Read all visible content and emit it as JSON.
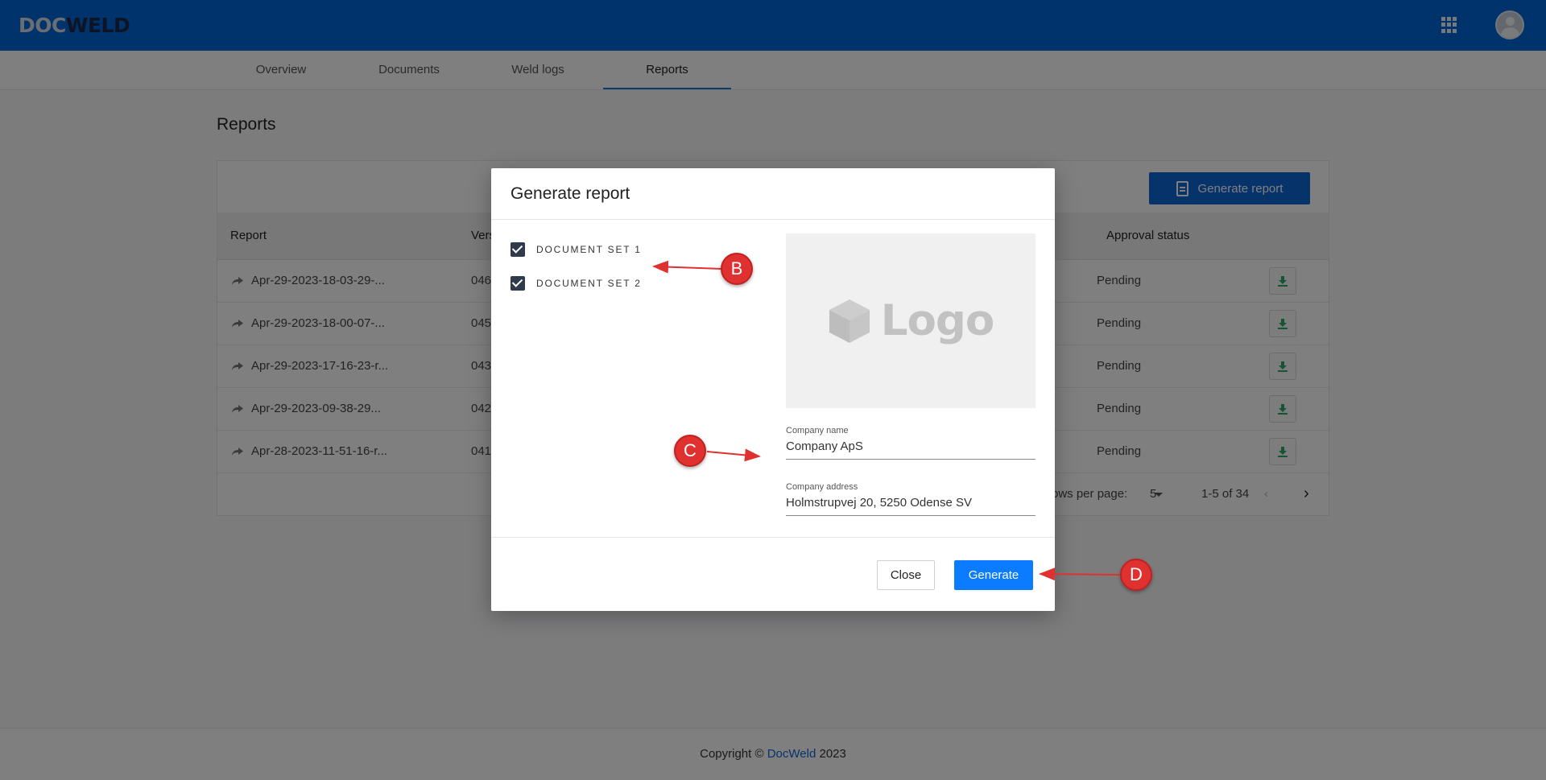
{
  "header": {
    "logo_doc": "DOC",
    "logo_weld": "WELD"
  },
  "tabs": [
    {
      "label": "Overview"
    },
    {
      "label": "Documents"
    },
    {
      "label": "Weld logs"
    },
    {
      "label": "Reports",
      "active": true
    }
  ],
  "page": {
    "title": "Reports",
    "generate_button": "Generate report"
  },
  "table": {
    "columns": [
      "Report",
      "Vers",
      "Approval status"
    ],
    "rows": [
      {
        "report": "Apr-29-2023-18-03-29-...",
        "version": "046",
        "status": "Pending"
      },
      {
        "report": "Apr-29-2023-18-00-07-...",
        "version": "045",
        "status": "Pending"
      },
      {
        "report": "Apr-29-2023-17-16-23-r...",
        "version": "043",
        "status": "Pending"
      },
      {
        "report": "Apr-29-2023-09-38-29...",
        "version": "042",
        "status": "Pending"
      },
      {
        "report": "Apr-28-2023-11-51-16-r...",
        "version": "041",
        "status": "Pending"
      }
    ],
    "pagination": {
      "rows_label": "ows per page:",
      "rows_value": "5",
      "range": "1-5 of 34"
    }
  },
  "footer": {
    "prefix": "Copyright ©",
    "brand": "DocWeld",
    "year": "2023"
  },
  "modal": {
    "title": "Generate report",
    "checkboxes": [
      {
        "label": "DOCUMENT SET 1",
        "checked": true
      },
      {
        "label": "DOCUMENT SET 2",
        "checked": true
      }
    ],
    "logo_placeholder": "Logo",
    "company_name_label": "Company name",
    "company_name_value": "Company ApS",
    "company_address_label": "Company address",
    "company_address_value": "Holmstrupvej 20, 5250 Odense SV",
    "close_button": "Close",
    "generate_button": "Generate"
  },
  "annotations": [
    "B",
    "C",
    "D"
  ],
  "colors": {
    "brand_blue": "#0064d9",
    "primary_button": "#0b7cff",
    "marker_red": "#e03131",
    "success_green": "#2ea86b"
  }
}
